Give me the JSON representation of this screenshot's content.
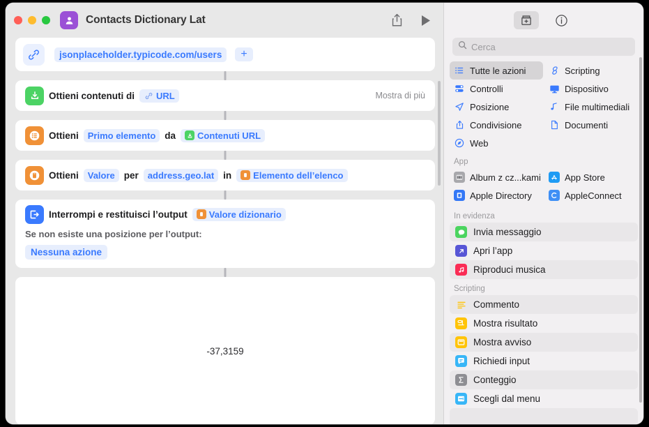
{
  "window": {
    "traffic_lights": [
      "close",
      "minimize",
      "zoom"
    ],
    "app_icon": "contacts-person-icon",
    "title": "Contacts Dictionary Lat",
    "share_icon": "share-icon",
    "run_icon": "play-icon",
    "accent_blue": "#3a7afe",
    "accent_purple": "#9b51d6"
  },
  "workflow": {
    "url_row": {
      "icon": "link-icon",
      "url": "jsonplaceholder.typicode.com/users",
      "add_label": "+"
    },
    "actions": [
      {
        "icon": "get-contents-of-url-icon",
        "icon_color": "#4cd364",
        "text_parts": [
          {
            "kind": "text",
            "value": "Ottieni contenuti di"
          },
          {
            "kind": "pill",
            "value": "URL",
            "chip": "link-chip-icon",
            "chip_color": "#8aa9f2"
          }
        ],
        "trailing": "Mostra di più"
      },
      {
        "icon": "get-item-from-list-icon",
        "icon_color": "#f09137",
        "text_parts": [
          {
            "kind": "text",
            "value": "Ottieni"
          },
          {
            "kind": "pill",
            "value": "Primo elemento"
          },
          {
            "kind": "text",
            "value": "da"
          },
          {
            "kind": "pill",
            "value": "Contenuti URL",
            "chip": "url-contents-chip-icon",
            "chip_color": "#4cd364"
          }
        ],
        "trailing": ""
      },
      {
        "icon": "get-dictionary-value-icon",
        "icon_color": "#f09137",
        "text_parts": [
          {
            "kind": "text",
            "value": "Ottieni"
          },
          {
            "kind": "pill",
            "value": "Valore"
          },
          {
            "kind": "text",
            "value": "per"
          },
          {
            "kind": "pill",
            "value": "address.geo.lat"
          },
          {
            "kind": "text",
            "value": "in"
          },
          {
            "kind": "pill",
            "value": "Elemento dell’elenco",
            "chip": "list-item-chip-icon",
            "chip_color": "#f09137"
          }
        ],
        "trailing": ""
      }
    ],
    "stop_action": {
      "icon": "stop-and-output-icon",
      "icon_color": "#3a7afe",
      "title": "Interrompi e restituisci l’output",
      "value_pill": "Valore dizionario",
      "value_pill_chip": "dictionary-chip-icon",
      "value_pill_chip_color": "#f09137",
      "sub_label": "Se non esiste una posizione per l’output:",
      "sub_pill": "Nessuna azione"
    },
    "output": {
      "value": "-37,3159"
    }
  },
  "sidebar": {
    "toolbar": [
      {
        "name": "action-library-button",
        "icon": "library-add-icon",
        "active": true
      },
      {
        "name": "info-button",
        "icon": "info-circle-icon",
        "active": false
      }
    ],
    "search": {
      "icon": "search-icon",
      "placeholder": "Cerca",
      "value": ""
    },
    "categories": [
      {
        "label": "Tutte le azioni",
        "icon": "list-bullet-icon",
        "selected": true
      },
      {
        "label": "Scripting",
        "icon": "scripting-icon",
        "selected": false
      },
      {
        "label": "Controlli",
        "icon": "controls-icon",
        "selected": false
      },
      {
        "label": "Dispositivo",
        "icon": "device-icon",
        "selected": false
      },
      {
        "label": "Posizione",
        "icon": "location-arrow-icon",
        "selected": false
      },
      {
        "label": "File multimediali",
        "icon": "media-note-icon",
        "selected": false
      },
      {
        "label": "Condivisione",
        "icon": "share-icon",
        "selected": false
      },
      {
        "label": "Documenti",
        "icon": "document-icon",
        "selected": false
      },
      {
        "label": "Web",
        "icon": "compass-icon",
        "selected": false
      }
    ],
    "app_section": {
      "title": "App",
      "items": [
        {
          "label": "Album z cz...kami",
          "icon": "album-app-icon",
          "color": "#9a9a9e"
        },
        {
          "label": "App Store",
          "icon": "app-store-icon",
          "color": "#1f9bf4"
        },
        {
          "label": "Apple Directory",
          "icon": "apple-directory-icon",
          "color": "#3478f6"
        },
        {
          "label": "AppleConnect",
          "icon": "appleconnect-icon",
          "color": "#3f8ff5"
        }
      ]
    },
    "featured_section": {
      "title": "In evidenza",
      "items": [
        {
          "label": "Invia messaggio",
          "icon": "messages-icon",
          "color": "#4bd45f",
          "alt": true
        },
        {
          "label": "Apri l’app",
          "icon": "open-app-icon",
          "color": "#5856d6",
          "alt": false
        },
        {
          "label": "Riproduci musica",
          "icon": "music-icon",
          "color": "#fa2c55",
          "alt": true
        }
      ]
    },
    "scripting_section": {
      "title": "Scripting",
      "items": [
        {
          "label": "Commento",
          "icon": "comment-lines-icon",
          "color": "#ffffff",
          "alt": true
        },
        {
          "label": "Mostra risultato",
          "icon": "show-result-icon",
          "color": "#ffc409",
          "alt": false
        },
        {
          "label": "Mostra avviso",
          "icon": "show-alert-icon",
          "color": "#ffc409",
          "alt": true
        },
        {
          "label": "Richiedi input",
          "icon": "ask-for-input-icon",
          "color": "#38b6f7",
          "alt": false
        },
        {
          "label": "Conteggio",
          "icon": "count-sigma-icon",
          "color": "#8e8e93",
          "alt": true
        },
        {
          "label": "Scegli dal menu",
          "icon": "choose-from-menu-icon",
          "color": "#38b6f7",
          "alt": false
        },
        {
          "label": "",
          "icon": "",
          "color": "#8e8e93",
          "alt": true
        }
      ]
    }
  }
}
